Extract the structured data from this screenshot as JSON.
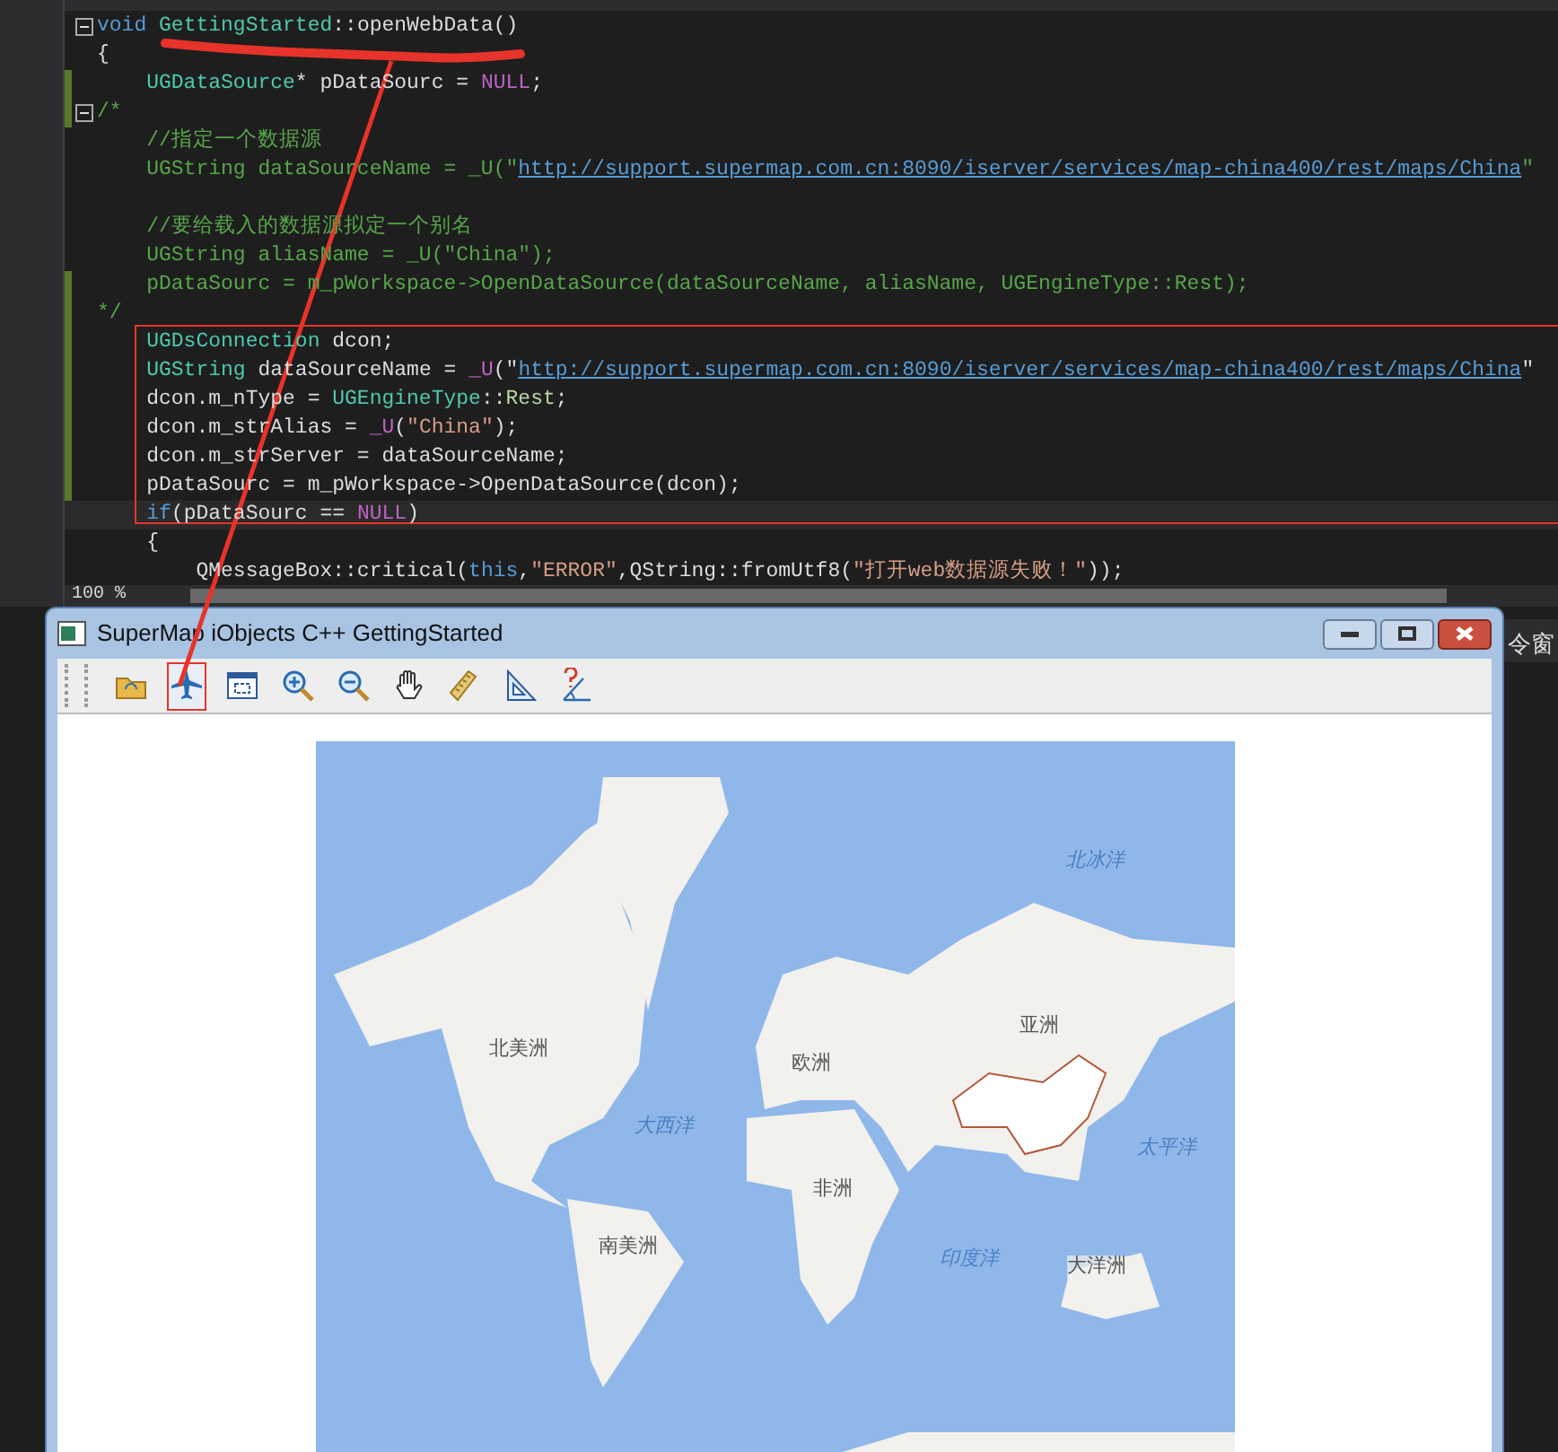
{
  "editor": {
    "lines": [
      {
        "kind": "code",
        "fold": true,
        "modified": false,
        "tokens": [
          {
            "kind": "keyword",
            "text": "void "
          },
          {
            "kind": "type",
            "text": "GettingStarted"
          },
          {
            "kind": "plain",
            "text": "::openWebData()"
          }
        ]
      },
      {
        "kind": "code",
        "fold": false,
        "modified": false,
        "tokens": [
          {
            "kind": "plain",
            "text": "{"
          }
        ]
      },
      {
        "kind": "code",
        "fold": false,
        "modified": true,
        "tokens": [
          {
            "kind": "type",
            "text": "    UGDataSource"
          },
          {
            "kind": "plain",
            "text": "* pDataSourc = "
          },
          {
            "kind": "macro",
            "text": "NULL"
          },
          {
            "kind": "plain",
            "text": ";"
          }
        ]
      },
      {
        "kind": "code",
        "fold": true,
        "modified": true,
        "tokens": [
          {
            "kind": "comment",
            "text": "/*"
          }
        ]
      },
      {
        "kind": "code",
        "fold": false,
        "modified": false,
        "tokens": [
          {
            "kind": "comment",
            "text": "    //指定一个数据源"
          }
        ]
      },
      {
        "kind": "code",
        "fold": false,
        "modified": false,
        "tokens": [
          {
            "kind": "comment",
            "text": "    UGString dataSourceName = _U(\""
          },
          {
            "kind": "url",
            "text": "http://support.supermap.com.cn:8090/iserver/services/map-china400/rest/maps/China"
          },
          {
            "kind": "comment",
            "text": "\""
          }
        ]
      },
      {
        "kind": "blank"
      },
      {
        "kind": "code",
        "fold": false,
        "modified": false,
        "tokens": [
          {
            "kind": "comment",
            "text": "    //要给载入的数据源拟定一个别名"
          }
        ]
      },
      {
        "kind": "code",
        "fold": false,
        "modified": false,
        "tokens": [
          {
            "kind": "comment",
            "text": "    UGString aliasName = _U(\"China\");"
          }
        ]
      },
      {
        "kind": "code",
        "fold": false,
        "modified": true,
        "tokens": [
          {
            "kind": "comment",
            "text": "    pDataSourc = m_pWorkspace->OpenDataSource(dataSourceName, aliasName, UGEngineType::Rest);"
          }
        ]
      },
      {
        "kind": "code",
        "fold": false,
        "modified": true,
        "tokens": [
          {
            "kind": "comment",
            "text": "*/"
          }
        ]
      },
      {
        "kind": "code",
        "fold": false,
        "modified": true,
        "tokens": [
          {
            "kind": "type",
            "text": "    UGDsConnection"
          },
          {
            "kind": "plain",
            "text": " dcon;"
          }
        ]
      },
      {
        "kind": "code",
        "fold": false,
        "modified": true,
        "tokens": [
          {
            "kind": "type",
            "text": "    UGString"
          },
          {
            "kind": "plain",
            "text": " dataSourceName = "
          },
          {
            "kind": "macro",
            "text": "_U"
          },
          {
            "kind": "plain",
            "text": "(\""
          },
          {
            "kind": "url",
            "text": "http://support.supermap.com.cn:8090/iserver/services/map-china400/rest/maps/China"
          },
          {
            "kind": "plain",
            "text": "\""
          }
        ]
      },
      {
        "kind": "code",
        "fold": false,
        "modified": true,
        "tokens": [
          {
            "kind": "plain",
            "text": "    dcon.m_nType = "
          },
          {
            "kind": "type",
            "text": "UGEngineType"
          },
          {
            "kind": "plain",
            "text": "::"
          },
          {
            "kind": "enum",
            "text": "Rest"
          },
          {
            "kind": "plain",
            "text": ";"
          }
        ]
      },
      {
        "kind": "code",
        "fold": false,
        "modified": true,
        "tokens": [
          {
            "kind": "plain",
            "text": "    dcon.m_strAlias = "
          },
          {
            "kind": "macro",
            "text": "_U"
          },
          {
            "kind": "plain",
            "text": "("
          },
          {
            "kind": "string",
            "text": "\"China\""
          },
          {
            "kind": "plain",
            "text": ");"
          }
        ]
      },
      {
        "kind": "code",
        "fold": false,
        "modified": true,
        "tokens": [
          {
            "kind": "plain",
            "text": "    dcon.m_strServer = dataSourceName;"
          }
        ]
      },
      {
        "kind": "code",
        "fold": false,
        "modified": true,
        "tokens": [
          {
            "kind": "plain",
            "text": "    pDataSourc = m_pWorkspace->OpenDataSource(dcon);"
          }
        ]
      },
      {
        "kind": "code",
        "fold": false,
        "modified": false,
        "current": true,
        "tokens": [
          {
            "kind": "keyword",
            "text": "    if"
          },
          {
            "kind": "plain",
            "text": "(pDataSourc == "
          },
          {
            "kind": "macro",
            "text": "NULL"
          },
          {
            "kind": "plain",
            "text": ")"
          }
        ]
      },
      {
        "kind": "code",
        "fold": false,
        "modified": false,
        "tokens": [
          {
            "kind": "plain",
            "text": "    {"
          }
        ]
      },
      {
        "kind": "code",
        "fold": false,
        "modified": false,
        "tokens": [
          {
            "kind": "plain",
            "text": "        QMessageBox::critical("
          },
          {
            "kind": "keyword",
            "text": "this"
          },
          {
            "kind": "plain",
            "text": ","
          },
          {
            "kind": "string",
            "text": "\"ERROR\""
          },
          {
            "kind": "plain",
            "text": ",QString::fromUtf8("
          },
          {
            "kind": "string",
            "text": "\"打开web数据源失败！\""
          },
          {
            "kind": "plain",
            "text": "));"
          }
        ]
      }
    ],
    "zoom": "100 %"
  },
  "side_panel": {
    "label": "令窗"
  },
  "window": {
    "title": "SuperMap iObjects C++ GettingStarted"
  },
  "toolbar": {
    "buttons": [
      {
        "kind": "open",
        "selected": false
      },
      {
        "kind": "plane",
        "selected": true
      },
      {
        "kind": "extent",
        "selected": false
      },
      {
        "kind": "zoom-in",
        "selected": false
      },
      {
        "kind": "zoom-out",
        "selected": false
      },
      {
        "kind": "pan",
        "selected": false
      },
      {
        "kind": "ruler",
        "selected": false
      },
      {
        "kind": "area",
        "selected": false
      },
      {
        "kind": "angle",
        "selected": false
      }
    ]
  },
  "map": {
    "labels": [
      {
        "text": "北冰洋",
        "kind": "ocean"
      },
      {
        "text": "亚洲",
        "kind": "continent"
      },
      {
        "text": "北美洲",
        "kind": "continent"
      },
      {
        "text": "欧洲",
        "kind": "continent"
      },
      {
        "text": "大西洋",
        "kind": "ocean"
      },
      {
        "text": "太平洋",
        "kind": "ocean"
      },
      {
        "text": "非洲",
        "kind": "continent"
      },
      {
        "text": "南美洲",
        "kind": "continent"
      },
      {
        "text": "印度洋",
        "kind": "ocean"
      },
      {
        "text": "大洋洲",
        "kind": "continent"
      }
    ]
  }
}
